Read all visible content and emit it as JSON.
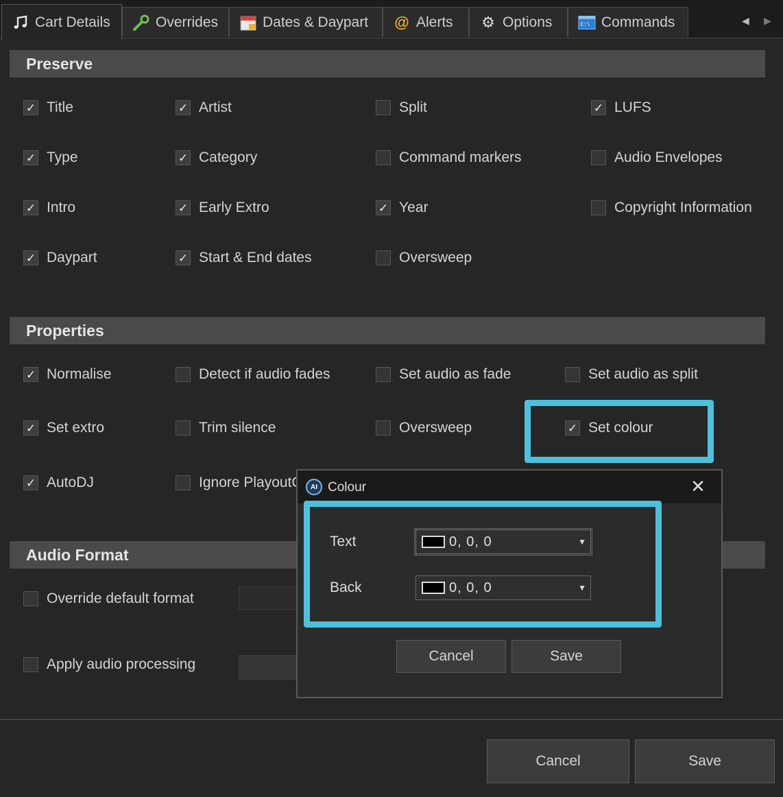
{
  "tabs": [
    {
      "label": "Cart Details",
      "icon": "music-note-icon",
      "active": true
    },
    {
      "label": "Overrides",
      "icon": "wrench-icon"
    },
    {
      "label": "Dates & Daypart",
      "icon": "calendar-icon"
    },
    {
      "label": "Alerts",
      "icon": "at-sign-icon"
    },
    {
      "label": "Options",
      "icon": "gear-icon"
    },
    {
      "label": "Commands",
      "icon": "command-prompt-icon"
    }
  ],
  "preserve": {
    "title": "Preserve",
    "items": [
      {
        "label": "Title",
        "checked": true
      },
      {
        "label": "Artist",
        "checked": true
      },
      {
        "label": "Split",
        "checked": false
      },
      {
        "label": "LUFS",
        "checked": true
      },
      {
        "label": "Type",
        "checked": true
      },
      {
        "label": "Category",
        "checked": true
      },
      {
        "label": "Command markers",
        "checked": false
      },
      {
        "label": "Audio Envelopes",
        "checked": false
      },
      {
        "label": "Intro",
        "checked": true
      },
      {
        "label": "Early Extro",
        "checked": true
      },
      {
        "label": "Year",
        "checked": true
      },
      {
        "label": "Copyright Information",
        "checked": false
      },
      {
        "label": "Daypart",
        "checked": true
      },
      {
        "label": "Start & End dates",
        "checked": true
      },
      {
        "label": "Oversweep",
        "checked": false
      }
    ]
  },
  "properties": {
    "title": "Properties",
    "items": [
      {
        "label": "Normalise",
        "checked": true
      },
      {
        "label": "Detect if audio fades",
        "checked": false
      },
      {
        "label": "Set audio as fade",
        "checked": false
      },
      {
        "label": "Set audio as split",
        "checked": false
      },
      {
        "label": "Set extro",
        "checked": true
      },
      {
        "label": "Trim silence",
        "checked": false
      },
      {
        "label": "Oversweep",
        "checked": false
      },
      {
        "label": "Set colour",
        "checked": true
      },
      {
        "label": "AutoDJ",
        "checked": true
      },
      {
        "label": "Ignore PlayoutC",
        "checked": false
      }
    ]
  },
  "audio_format": {
    "title": "Audio Format",
    "items": [
      {
        "label": "Override default format",
        "checked": false
      },
      {
        "label": "Apply audio processing",
        "checked": false
      }
    ]
  },
  "footer": {
    "cancel": "Cancel",
    "save": "Save"
  },
  "dialog": {
    "app_badge": "AI",
    "title": "Colour",
    "close": "✕",
    "text_label": "Text",
    "text_value": "0, 0, 0",
    "back_label": "Back",
    "back_value": "0, 0, 0",
    "swatch_color": "#000000",
    "cancel": "Cancel",
    "save": "Save"
  },
  "colors": {
    "highlight": "#4cc1de"
  }
}
